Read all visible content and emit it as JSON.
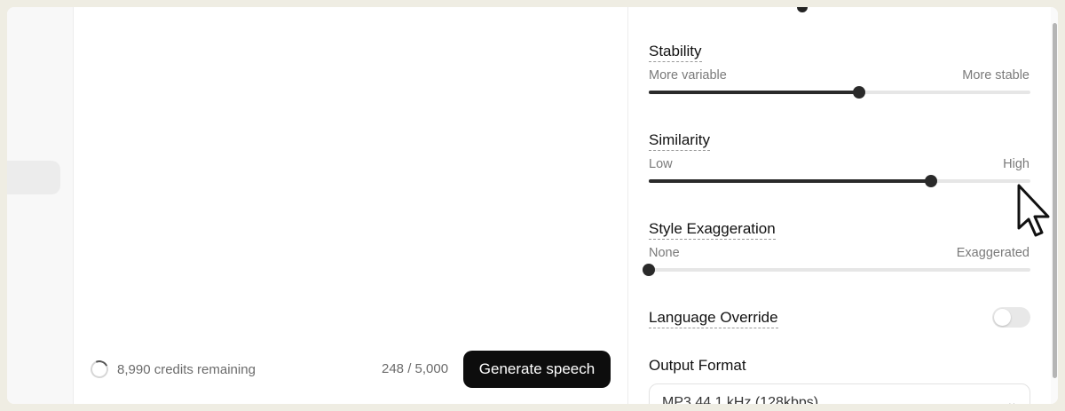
{
  "footer": {
    "credits_remaining": "8,990 credits remaining",
    "char_count": "248 / 5,000",
    "generate_label": "Generate speech"
  },
  "settings": {
    "stability": {
      "title": "Stability",
      "min_label": "More variable",
      "max_label": "More stable",
      "value": 0.55
    },
    "similarity": {
      "title": "Similarity",
      "min_label": "Low",
      "max_label": "High",
      "value": 0.74
    },
    "style_exaggeration": {
      "title": "Style Exaggeration",
      "min_label": "None",
      "max_label": "Exaggerated",
      "value": 0.0
    },
    "language_override": {
      "title": "Language Override",
      "enabled": false
    },
    "output_format": {
      "title": "Output Format",
      "selected": "MP3 44.1 kHz (128kbps)"
    }
  },
  "icons": {
    "credits": "loading-ring-icon",
    "select_arrow": "chevron-down-icon",
    "cursor": "mouse-pointer-icon"
  },
  "colors": {
    "primary_button": "#0d0d0d",
    "slider_active": "#2a2a2a",
    "slider_track": "#e6e6e6",
    "background": "#efede3"
  }
}
